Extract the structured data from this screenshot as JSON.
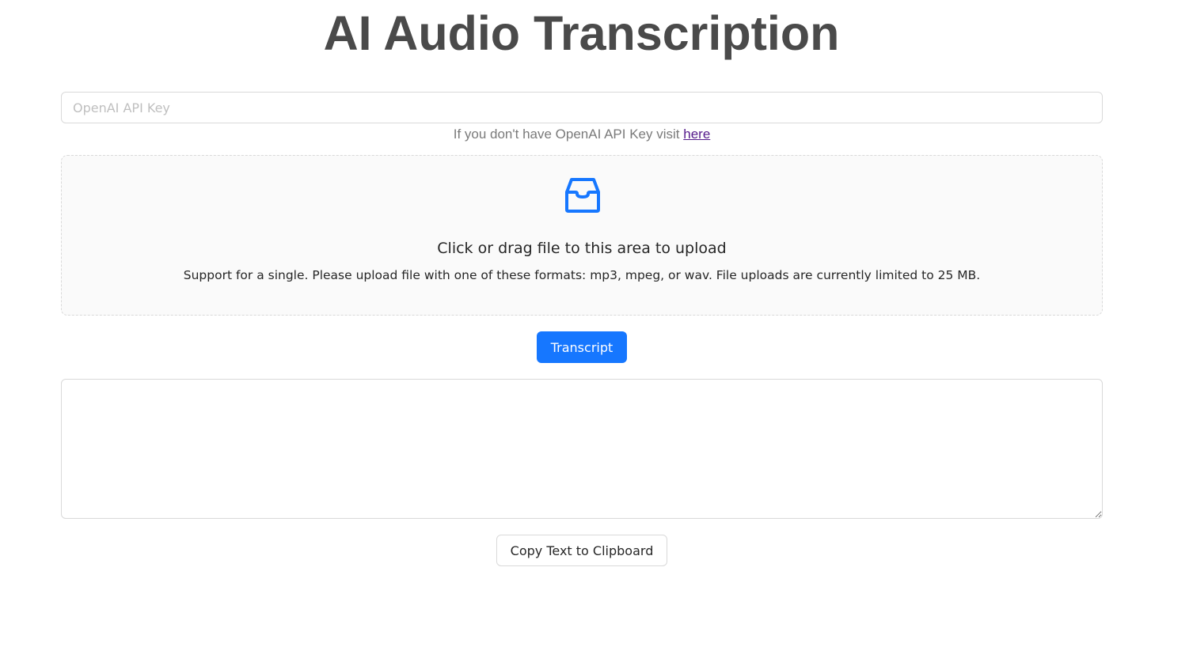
{
  "header": {
    "title": "AI Audio Transcription"
  },
  "api_key": {
    "placeholder": "OpenAI API Key",
    "value": "",
    "hint_text": "If you don't have OpenAI API Key visit ",
    "hint_link": "here"
  },
  "upload": {
    "icon": "inbox-icon",
    "title": "Click or drag file to this area to upload",
    "hint": "Support for a single. Please upload file with one of these formats: mp3, mpeg, or wav. File uploads are currently limited to 25 MB."
  },
  "actions": {
    "transcript_label": "Transcript",
    "copy_label": "Copy Text to Clipboard"
  },
  "output": {
    "value": ""
  },
  "colors": {
    "primary": "#1677ff",
    "title": "#4a4a4a",
    "border": "#d9d9d9",
    "dropzone_bg": "#fafafa",
    "link": "#551a8b"
  }
}
